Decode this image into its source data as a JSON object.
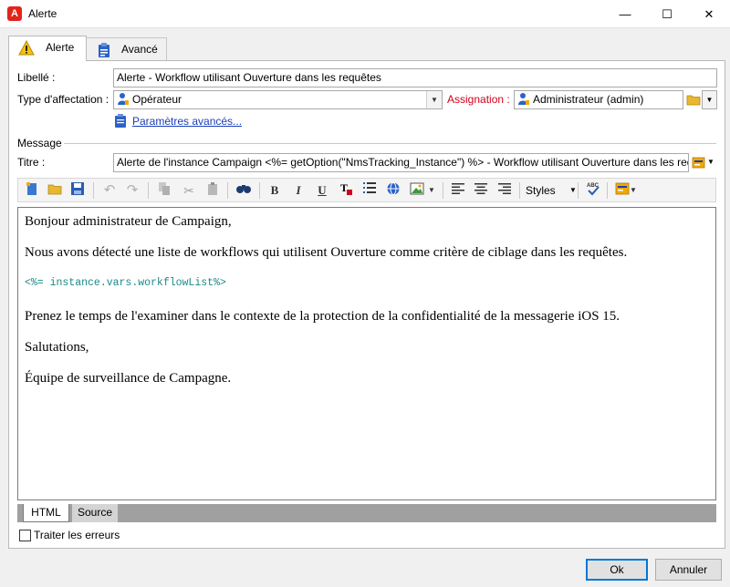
{
  "window": {
    "title": "Alerte",
    "min": "—",
    "max": "☐",
    "close": "✕"
  },
  "tabs": [
    {
      "label": "Alerte",
      "icon": "warning-icon",
      "active": true
    },
    {
      "label": "Avancé",
      "icon": "clipboard-icon",
      "active": false
    }
  ],
  "form": {
    "libelle_label": "Libellé :",
    "libelle_value": "Alerte - Workflow utilisant Ouverture dans les requêtes",
    "type_label": "Type d'affectation :",
    "type_value": "Opérateur",
    "assignation_label": "Assignation :",
    "assignation_value": "Administrateur (admin)",
    "params_link": "Paramètres avancés...",
    "message_label": "Message",
    "titre_label": "Titre :",
    "titre_value": "Alerte de l'instance Campaign <%= getOption(\"NmsTracking_Instance\") %> - Workflow utilisant Ouverture dans les req"
  },
  "toolbar": {
    "styles_label": "Styles"
  },
  "editor": {
    "p1": "Bonjour administrateur de Campaign,",
    "p2": "Nous avons détecté une liste de workflows qui utilisent Ouverture comme critère de ciblage dans les requêtes.",
    "code": "<%= instance.vars.workflowList%>",
    "p3": "Prenez le temps de l'examiner dans le contexte de la protection de la confidentialité de la messagerie iOS 15.",
    "p4": "Salutations,",
    "p5": "Équipe de surveillance de Campagne."
  },
  "bottom_tabs": {
    "html": "HTML",
    "source": "Source"
  },
  "checkbox": {
    "label": "Traiter les erreurs",
    "checked": false
  },
  "buttons": {
    "ok": "Ok",
    "cancel": "Annuler"
  },
  "colors": {
    "assignation_label": "#d0021b",
    "link": "#1a3fb8",
    "code": "#1b8a8a",
    "ok_border": "#0078d7"
  }
}
